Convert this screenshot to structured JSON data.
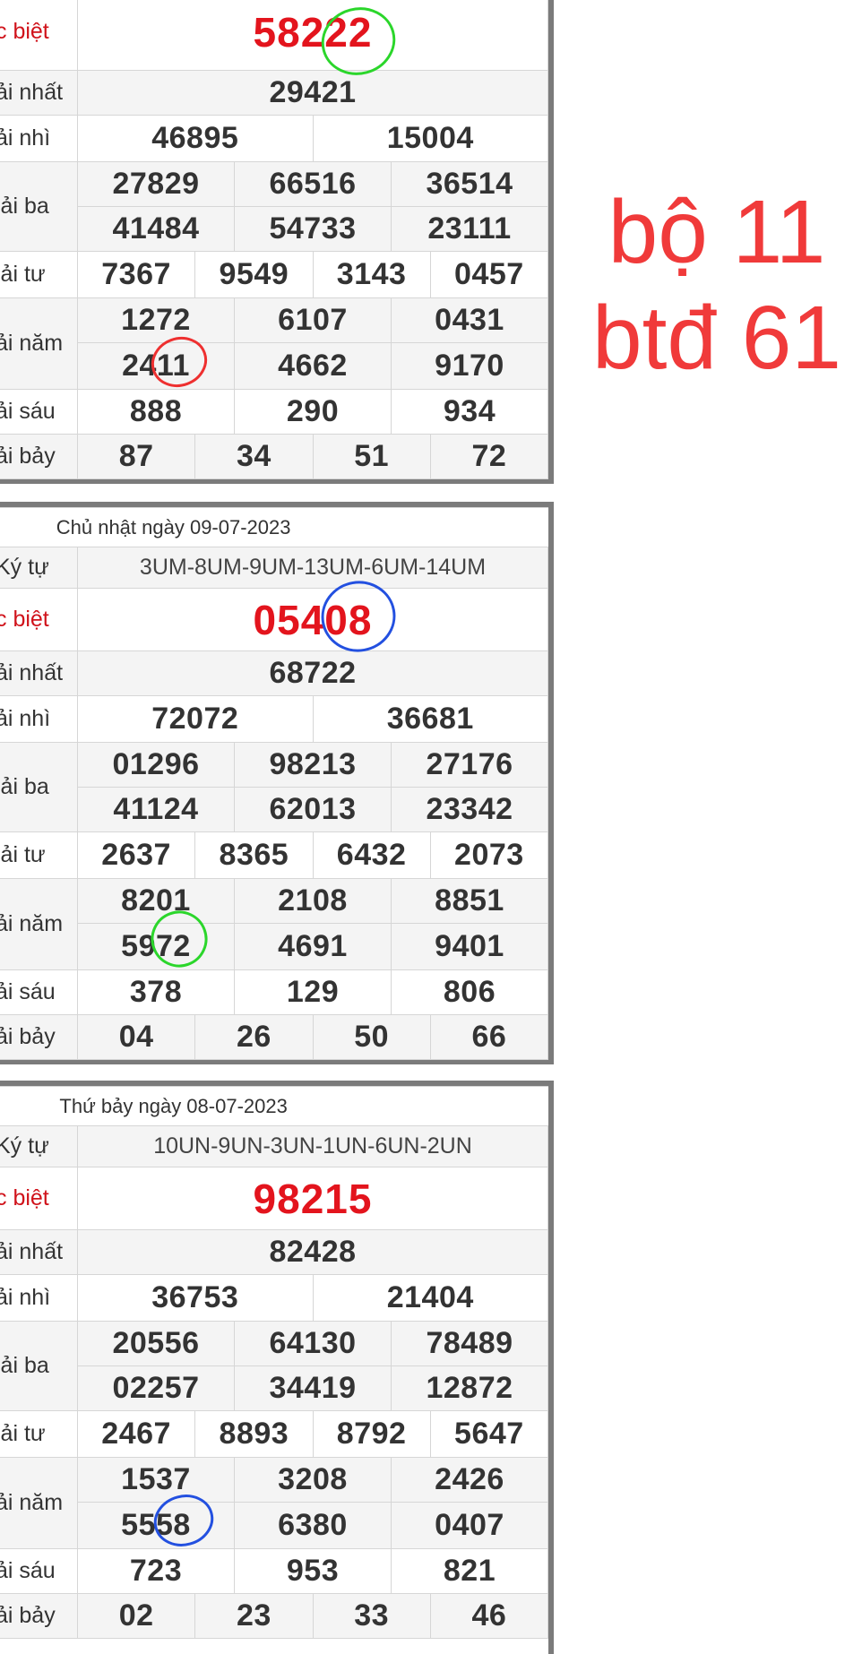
{
  "side_note": {
    "line1": "bộ 11",
    "line2": "btđ 61"
  },
  "labels": {
    "db": "c biệt",
    "g1": "ải nhất",
    "g2": "ải nhì",
    "g3": "iải ba",
    "g4": "iải tư",
    "g5": "ải năm",
    "g6": "ải sáu",
    "g7": "ải bảy",
    "codes": "Ký tự"
  },
  "boards": [
    {
      "db": "58222",
      "g1": "29421",
      "g2": [
        "46895",
        "15004"
      ],
      "g3a": [
        "27829",
        "66516",
        "36514"
      ],
      "g3b": [
        "41484",
        "54733",
        "23111"
      ],
      "g4": [
        "7367",
        "9549",
        "3143",
        "0457"
      ],
      "g5a": [
        "1272",
        "6107",
        "0431"
      ],
      "g5b": [
        "2411",
        "4662",
        "9170"
      ],
      "g6": [
        "888",
        "290",
        "934"
      ],
      "g7": [
        "87",
        "34",
        "51",
        "72"
      ]
    },
    {
      "date": "Chủ nhật ngày 09-07-2023",
      "codes": "3UM-8UM-9UM-13UM-6UM-14UM",
      "db": "05408",
      "g1": "68722",
      "g2": [
        "72072",
        "36681"
      ],
      "g3a": [
        "01296",
        "98213",
        "27176"
      ],
      "g3b": [
        "41124",
        "62013",
        "23342"
      ],
      "g4": [
        "2637",
        "8365",
        "6432",
        "2073"
      ],
      "g5a": [
        "8201",
        "2108",
        "8851"
      ],
      "g5b": [
        "5972",
        "4691",
        "9401"
      ],
      "g6": [
        "378",
        "129",
        "806"
      ],
      "g7": [
        "04",
        "26",
        "50",
        "66"
      ]
    },
    {
      "date": "Thứ bảy ngày 08-07-2023",
      "codes": "10UN-9UN-3UN-1UN-6UN-2UN",
      "db": "98215",
      "g1": "82428",
      "g2": [
        "36753",
        "21404"
      ],
      "g3a": [
        "20556",
        "64130",
        "78489"
      ],
      "g3b": [
        "02257",
        "34419",
        "12872"
      ],
      "g4": [
        "2467",
        "8893",
        "8792",
        "5647"
      ],
      "g5a": [
        "1537",
        "3208",
        "2426"
      ],
      "g5b": [
        "5558",
        "6380",
        "0407"
      ],
      "g6": [
        "723",
        "953",
        "821"
      ],
      "g7": [
        "02",
        "23",
        "33",
        "46"
      ]
    }
  ],
  "colors": {
    "special_number": "#e3141d",
    "note": "#f03a3a",
    "circle_green": "#2bd62b",
    "circle_blue": "#2350e0",
    "circle_red": "#ee3030",
    "frame": "#7b7b7b"
  }
}
